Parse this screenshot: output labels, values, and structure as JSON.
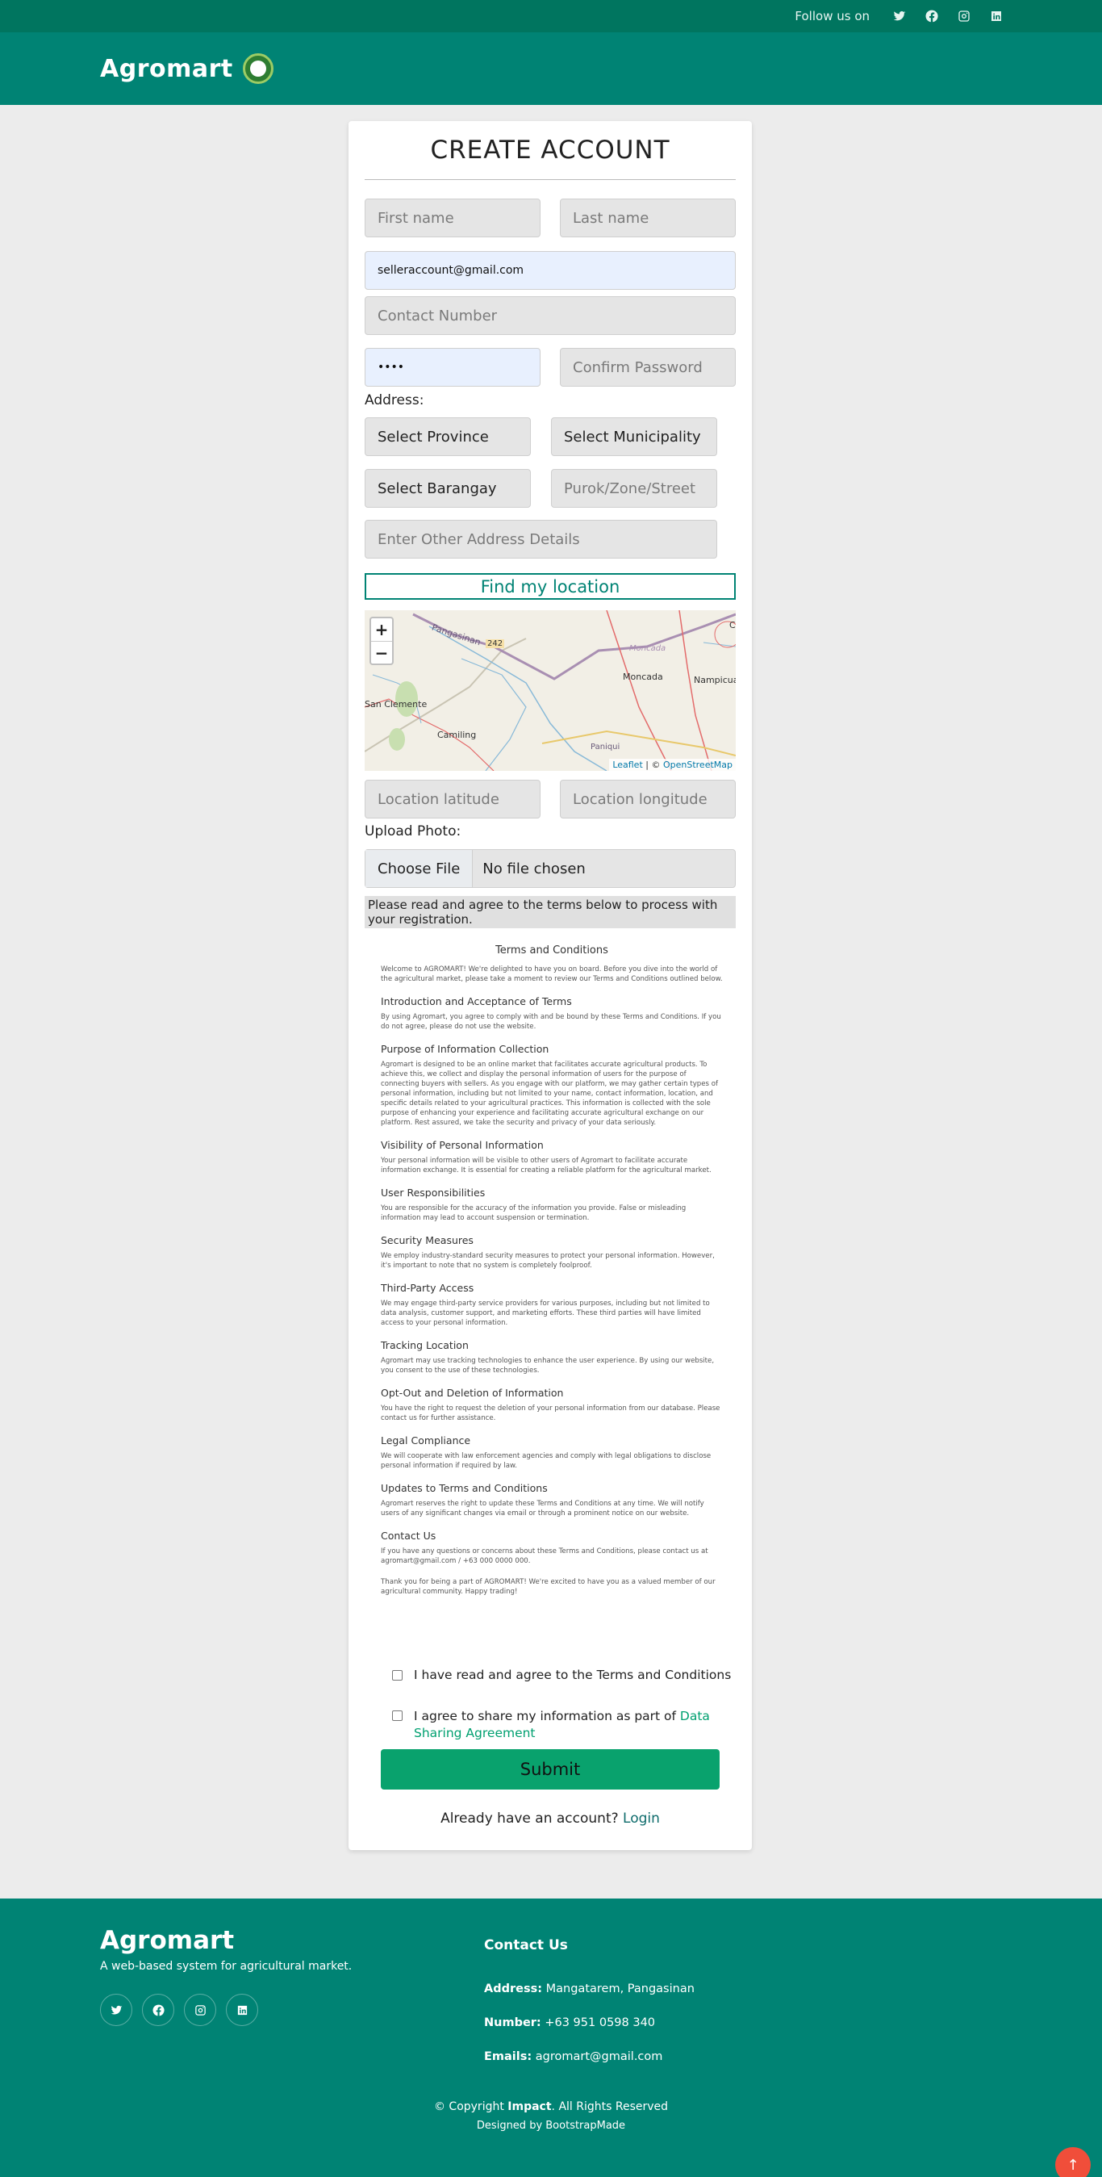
{
  "topbar": {
    "follow_label": "Follow us on",
    "socials": [
      "twitter-icon",
      "facebook-icon",
      "instagram-icon",
      "linkedin-icon"
    ]
  },
  "header": {
    "brand": "Agromart"
  },
  "form": {
    "title": "CREATE ACCOUNT",
    "first_name_placeholder": "First name",
    "last_name_placeholder": "Last name",
    "email_value": "selleraccount@gmail.com",
    "contact_placeholder": "Contact Number",
    "password_value": "••••",
    "confirm_password_placeholder": "Confirm Password",
    "address_label": "Address:",
    "province": "Select Province",
    "municipality": "Select Municipality",
    "barangay": "Select Barangay",
    "street_placeholder": "Purok/Zone/Street",
    "other_address_placeholder": "Enter Other Address Details",
    "find_location": "Find my location",
    "map": {
      "zoom_in": "+",
      "zoom_out": "−",
      "towns": [
        "Pangasinan",
        "242",
        "Moncada",
        "Moncada",
        "Nampicuan",
        "San Clemente",
        "Camiling",
        "Paniqui",
        "C"
      ],
      "attribution_leaflet": "Leaflet",
      "attribution_sep": " | © ",
      "attribution_osm": "OpenStreetMap"
    },
    "latitude_placeholder": "Location latitude",
    "longitude_placeholder": "Location longitude",
    "upload_label": "Upload Photo:",
    "choose_file": "Choose File",
    "no_file": "No file chosen",
    "notice": "Please read and agree to the terms below to process with your registration."
  },
  "terms": {
    "title": "Terms and Conditions",
    "intro": "Welcome to AGROMART! We're delighted to have you on board. Before you dive into the world of the agricultural market, please take a moment to review our Terms and Conditions outlined below.",
    "sections": [
      {
        "heading": "Introduction and Acceptance of Terms",
        "body": "By using Agromart, you agree to comply with and be bound by these Terms and Conditions. If you do not agree, please do not use the website."
      },
      {
        "heading": "Purpose of Information Collection",
        "body": "Agromart is designed to be an online market that facilitates accurate agricultural products. To achieve this, we collect and display the personal information of users for the purpose of connecting buyers with sellers. As you engage with our platform, we may gather certain types of personal information, including but not limited to your name, contact information, location, and specific details related to your agricultural practices. This information is collected with the sole purpose of enhancing your experience and facilitating accurate agricultural exchange on our platform. Rest assured, we take the security and privacy of your data seriously."
      },
      {
        "heading": "Visibility of Personal Information",
        "body": "Your personal information will be visible to other users of Agromart to facilitate accurate information exchange. It is essential for creating a reliable platform for the agricultural market."
      },
      {
        "heading": "User Responsibilities",
        "body": "You are responsible for the accuracy of the information you provide. False or misleading information may lead to account suspension or termination."
      },
      {
        "heading": "Security Measures",
        "body": "We employ industry-standard security measures to protect your personal information. However, it's important to note that no system is completely foolproof."
      },
      {
        "heading": "Third-Party Access",
        "body": "We may engage third-party service providers for various purposes, including but not limited to data analysis, customer support, and marketing efforts. These third parties will have limited access to your personal information."
      },
      {
        "heading": "Tracking Location",
        "body": "Agromart may use tracking technologies to enhance the user experience. By using our website, you consent to the use of these technologies."
      },
      {
        "heading": "Opt-Out and Deletion of Information",
        "body": "You have the right to request the deletion of your personal information from our database. Please contact us for further assistance."
      },
      {
        "heading": "Legal Compliance",
        "body": "We will cooperate with law enforcement agencies and comply with legal obligations to disclose personal information if required by law."
      },
      {
        "heading": "Updates to Terms and Conditions",
        "body": "Agromart reserves the right to update these Terms and Conditions at any time. We will notify users of any significant changes via email or through a prominent notice on our website."
      },
      {
        "heading": "Contact Us",
        "body": "If you have any questions or concerns about these Terms and Conditions, please contact us at agromart@gmail.com / +63 000 0000 000."
      }
    ],
    "closing": "Thank you for being a part of AGROMART! We're excited to have you as a valued member of our agricultural community. Happy trading!"
  },
  "agreements": {
    "terms_checkbox": "I have read and agree to the Terms and Conditions",
    "share_checkbox": "I agree to share my information as part of ",
    "share_link": "Data Sharing Agreement"
  },
  "submit_label": "Submit",
  "login": {
    "prompt": "Already have an account? ",
    "link": "Login"
  },
  "footer": {
    "brand": "Agromart",
    "tagline": "A web-based system for agricultural market.",
    "contact_heading": "Contact Us",
    "address_label": "Address:",
    "address_value": " Mangatarem, Pangasinan",
    "number_label": "Number:",
    "number_value": " +63 951 0598 340",
    "emails_label": "Emails:",
    "emails_value": " agromart@gmail.com",
    "copyright_pre": "© Copyright ",
    "copyright_brand": "Impact",
    "copyright_post": ". All Rights Reserved",
    "designed_by": "Designed by BootstrapMade"
  },
  "colors": {
    "brand": "#008374",
    "topbar": "#00755f",
    "submit": "#09a26d",
    "scroll_top": "#f04e3a"
  }
}
